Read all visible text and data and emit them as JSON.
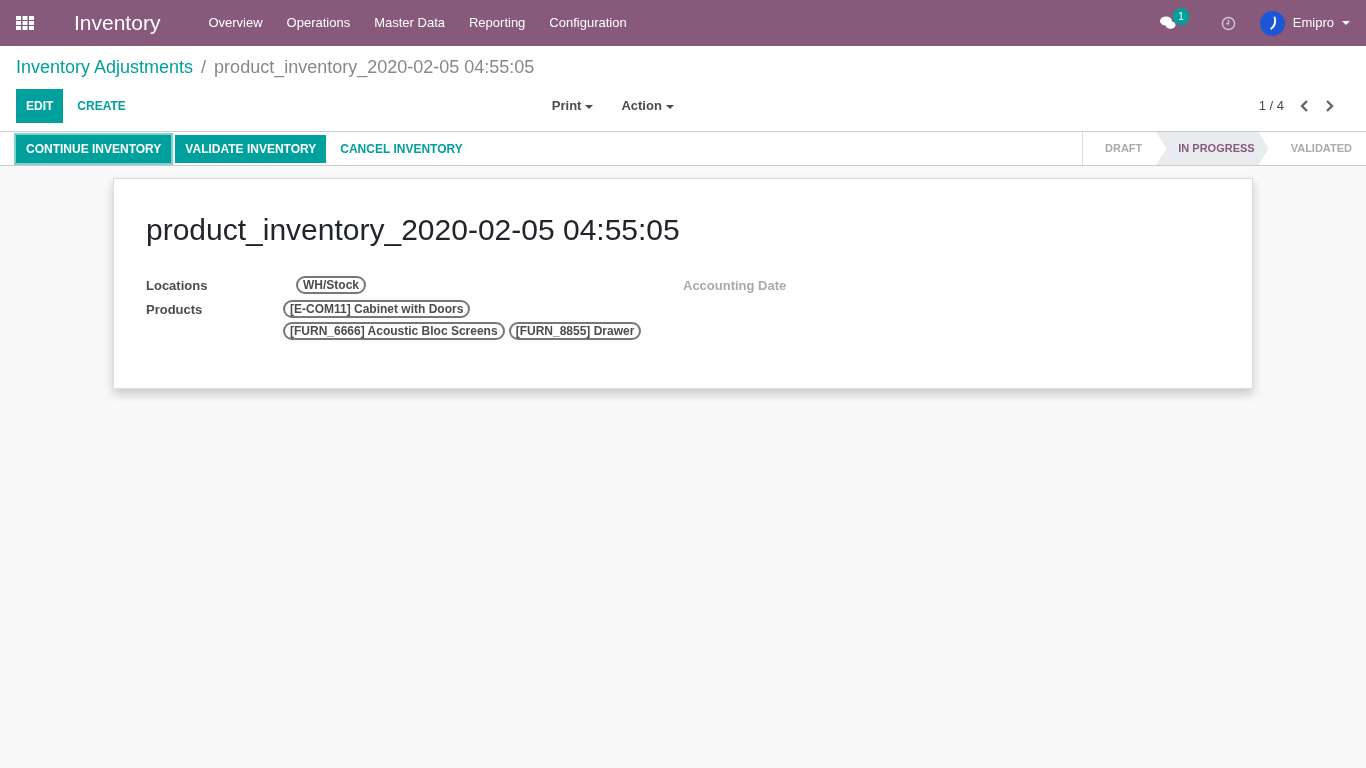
{
  "navbar": {
    "app_title": "Inventory",
    "menu": [
      "Overview",
      "Operations",
      "Master Data",
      "Reporting",
      "Configuration"
    ],
    "messages_badge": "1",
    "user": "Emipro"
  },
  "breadcrumb": {
    "parent": "Inventory Adjustments",
    "separator": "/",
    "current": "product_inventory_2020-02-05 04:55:05"
  },
  "control_panel": {
    "buttons": [
      {
        "label": "EDIT",
        "kind": "primary"
      },
      {
        "label": "CREATE",
        "kind": "link"
      }
    ],
    "dropdowns": [
      "Print",
      "Action"
    ],
    "pager": "1 / 4"
  },
  "statusbar": {
    "buttons": [
      {
        "label": "CONTINUE INVENTORY",
        "kind": "primary",
        "focused": true
      },
      {
        "label": "VALIDATE INVENTORY",
        "kind": "primary",
        "focused": false
      },
      {
        "label": "CANCEL INVENTORY",
        "kind": "link",
        "focused": false
      }
    ],
    "stages": [
      {
        "label": "DRAFT",
        "selected": false
      },
      {
        "label": "IN PROGRESS",
        "selected": true
      },
      {
        "label": "VALIDATED",
        "selected": false
      }
    ]
  },
  "form": {
    "title": "product_inventory_2020-02-05 04:55:05",
    "fields": [
      {
        "label": "Locations",
        "tags": [
          "WH/Stock"
        ]
      },
      {
        "label": "Products",
        "tags": [
          "[E-COM11] Cabinet with Doors",
          "[FURN_6666] Acoustic Bloc Screens",
          "[FURN_8855] Drawer"
        ]
      }
    ],
    "right_fields": [
      {
        "label": "Accounting Date"
      }
    ]
  }
}
